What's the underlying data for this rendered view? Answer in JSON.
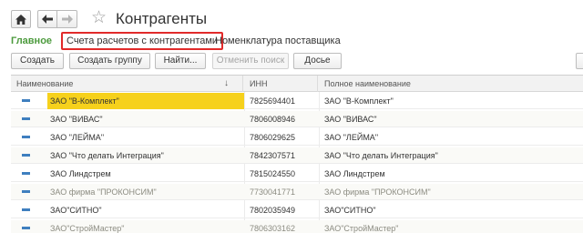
{
  "header": {
    "title": "Контрагенты",
    "home_icon": "home-icon",
    "back_icon": "arrow-left-icon",
    "forward_icon": "arrow-right-icon",
    "favorite_icon": "star-icon"
  },
  "sections": {
    "main": "Главное",
    "accounts": "Счета расчетов с контрагентами",
    "nomenclature": "Номенклатура поставщика"
  },
  "toolbar": {
    "create": "Создать",
    "create_group": "Создать группу",
    "find": "Найти...",
    "cancel_search": "Отменить поиск",
    "more": "Досье"
  },
  "table": {
    "columns": [
      "Наименование",
      "ИНН",
      "Полное наименование"
    ],
    "sort_indicator": "↓",
    "rows": [
      {
        "name": "ЗАО \"В-Комплект\"",
        "inn": "7825694401",
        "full": "ЗАО \"В-Комплект\"",
        "selected": true,
        "muted": false
      },
      {
        "name": "ЗАО \"ВИВАС\"",
        "inn": "7806008946",
        "full": "ЗАО \"ВИВАС\"",
        "selected": false,
        "muted": false
      },
      {
        "name": "ЗАО \"ЛЕЙМА\"",
        "inn": "7806029625",
        "full": "ЗАО \"ЛЕЙМА\"",
        "selected": false,
        "muted": false
      },
      {
        "name": "ЗАО \"Что делать Интеграция\"",
        "inn": "7842307571",
        "full": "ЗАО \"Что делать Интеграция\"",
        "selected": false,
        "muted": false
      },
      {
        "name": "ЗАО Линдстрем",
        "inn": "7815024550",
        "full": "ЗАО Линдстрем",
        "selected": false,
        "muted": false
      },
      {
        "name": "ЗАО фирма \"ПРОКОНСИМ\"",
        "inn": "7730041771",
        "full": "ЗАО фирма \"ПРОКОНСИМ\"",
        "selected": false,
        "muted": true
      },
      {
        "name": "ЗАО\"СИТНО\"",
        "inn": "7802035949",
        "full": "ЗАО\"СИТНО\"",
        "selected": false,
        "muted": false
      },
      {
        "name": "ЗАО\"СтройМастер\"",
        "inn": "7806303162",
        "full": "ЗАО\"СтройМастер\"",
        "selected": false,
        "muted": true
      }
    ]
  },
  "colors": {
    "section_active": "#4b9a3c",
    "highlight_border": "#e12a2a",
    "selected_row": "#f6d11c",
    "row_icon": "#3f7fbf"
  }
}
